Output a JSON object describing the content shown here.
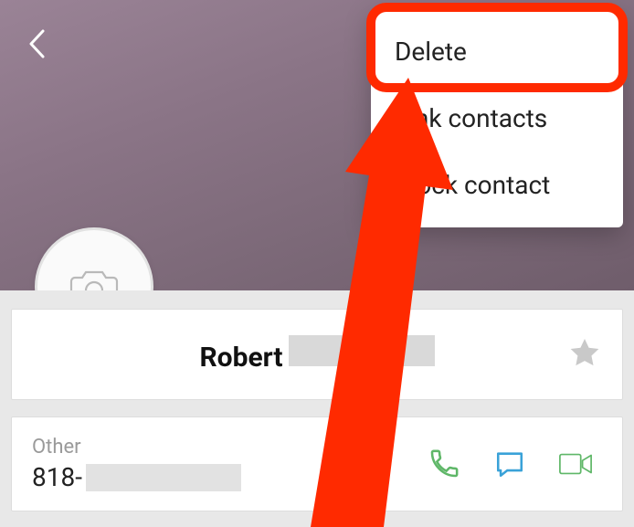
{
  "menu": {
    "items": [
      {
        "label": "Delete"
      },
      {
        "label": "Link contacts"
      },
      {
        "label": "Block contact"
      }
    ]
  },
  "contact": {
    "name_visible": "Robert",
    "phone_type": "Other",
    "phone_visible": "818-"
  },
  "annotation": {
    "highlight_target": "menu-item-delete",
    "arrow_color": "#ff2a00"
  }
}
